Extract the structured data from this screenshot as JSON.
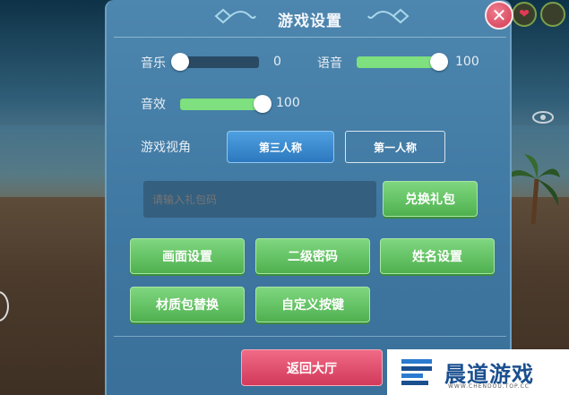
{
  "dialog": {
    "title": "游戏设置",
    "close_icon": "close-icon",
    "close_glyph": "✕"
  },
  "audio": {
    "music_label": "音乐",
    "music_value": "0",
    "music_level": 0,
    "voice_label": "语音",
    "voice_value": "100",
    "voice_level": 1,
    "sfx_label": "音效",
    "sfx_value": "100",
    "sfx_level": 1
  },
  "view": {
    "label": "游戏视角",
    "third_person": "第三人称",
    "first_person": "第一人称",
    "selected": "第三人称"
  },
  "gift": {
    "placeholder": "请输入礼包码",
    "redeem_label": "兑换礼包"
  },
  "buttons": {
    "graphics": "画面设置",
    "secondary_password": "二级密码",
    "name_settings": "姓名设置",
    "texture_pack": "材质包替换",
    "custom_keys": "自定义按键",
    "return_lobby": "返回大厅"
  },
  "hud": {
    "heart_glyph": "❤"
  },
  "watermark": {
    "brand": "晨道游戏",
    "url": "WWW.CHENDOU.TOP.CC"
  },
  "colors": {
    "panel": "#4079a3",
    "accent_green": "#6cc86c",
    "accent_blue": "#2c78bf",
    "danger_red": "#e04c6a"
  }
}
